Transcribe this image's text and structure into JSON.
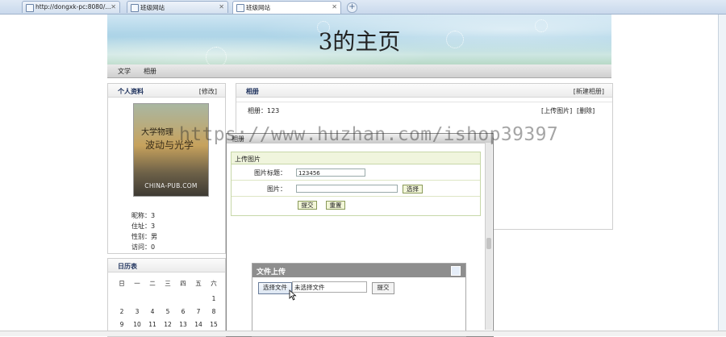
{
  "browser": {
    "tabs": [
      {
        "label": "http://dongxk-pc:8080/..."
      },
      {
        "label": "班级网站"
      },
      {
        "label": "班级网站"
      }
    ],
    "close_glyph": "✕",
    "new_tab_glyph": "+"
  },
  "header": {
    "title": "3的主页"
  },
  "nav": {
    "items": [
      "文学",
      "相册"
    ]
  },
  "profile": {
    "heading": "个人资料",
    "edit_link": "[修改]",
    "cover": {
      "title_line1": "大学物理",
      "title_line2": "波动与光学",
      "publisher_mark": "CHINA-PUB.COM"
    },
    "fields": [
      {
        "label": "昵称：",
        "value": "3"
      },
      {
        "label": "住址：",
        "value": "3"
      },
      {
        "label": "性别：",
        "value": "男"
      },
      {
        "label": "访问：",
        "value": "0"
      }
    ]
  },
  "calendar": {
    "heading": "日历表",
    "weekdays": [
      "日",
      "一",
      "二",
      "三",
      "四",
      "五",
      "六"
    ],
    "weeks": [
      [
        "",
        "",
        "",
        "",
        "",
        "",
        "1"
      ],
      [
        "2",
        "3",
        "4",
        "5",
        "6",
        "7",
        "8"
      ],
      [
        "9",
        "10",
        "11",
        "12",
        "13",
        "14",
        "15"
      ]
    ]
  },
  "album": {
    "heading": "相册",
    "new_link": "[新建相册]",
    "album_label": "相册：123",
    "upload_link": "[上传图片]",
    "delete_link": "[删除]"
  },
  "modal": {
    "title": "相册",
    "form_heading": "上传图片",
    "name_label": "图片标题：",
    "name_value": "123456",
    "image_label": "图片：",
    "image_value": "",
    "choose_button": "选择",
    "submit_button": "提交",
    "reset_button": "重置"
  },
  "file_upload": {
    "title": "文件上传",
    "choose_button": "选择文件",
    "no_file_text": "未选择文件",
    "submit_button": "提交"
  },
  "watermark": "https://www.huzhan.com/ishop39397"
}
